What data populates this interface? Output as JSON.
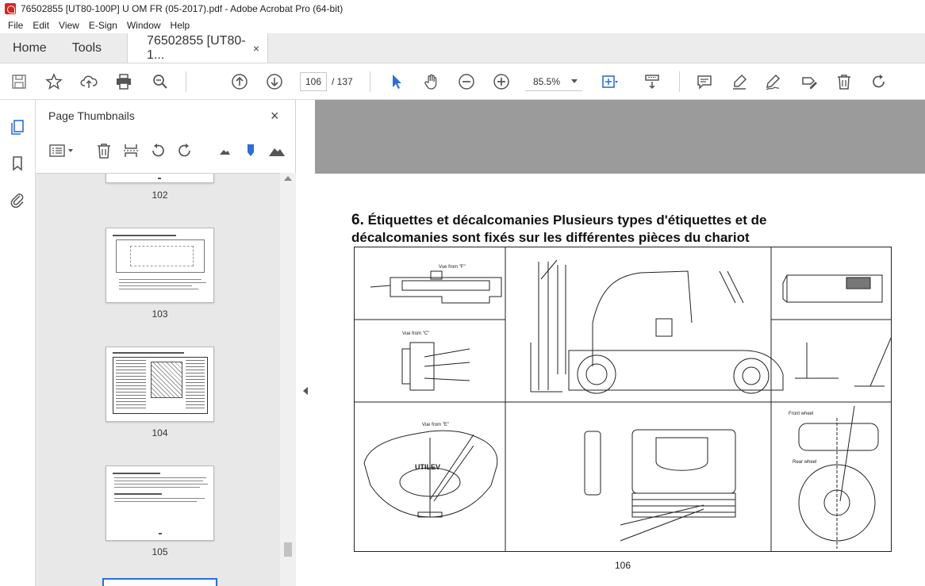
{
  "window": {
    "title": "76502855 [UT80-100P] U OM FR (05-2017).pdf - Adobe Acrobat Pro (64-bit)"
  },
  "menu": [
    "File",
    "Edit",
    "View",
    "E-Sign",
    "Window",
    "Help"
  ],
  "tabs": {
    "home": "Home",
    "tools": "Tools",
    "document": "76502855 [UT80-1...",
    "close": "×"
  },
  "toolbar": {
    "current_page": "106",
    "page_total": "/ 137",
    "zoom": "85.5%",
    "icons": [
      "save-icon",
      "star-icon",
      "upload-icon",
      "print-icon",
      "search-zoom-icon",
      "page-up-icon",
      "page-down-icon",
      "select-cursor-icon",
      "hand-icon",
      "zoom-out-icon",
      "zoom-in-icon",
      "zoom-dropdown-icon",
      "fit-page-icon",
      "scroll-mode-icon",
      "comment-icon",
      "highlight-icon",
      "sign-icon",
      "edit-icon",
      "delete-icon",
      "redo-icon"
    ]
  },
  "rail": {
    "icons": [
      "pages-icon",
      "bookmark-icon",
      "attachment-icon"
    ]
  },
  "panel": {
    "title": "Page Thumbnails",
    "close": "×",
    "tools": [
      "options-menu-icon",
      "delete-page-icon",
      "extract-page-icon",
      "rotate-ccw-icon",
      "rotate-cw-icon",
      "small-thumbnails-icon",
      "zoom-slider-icon",
      "large-thumbnails-icon"
    ],
    "thumbnails": [
      {
        "page": "102"
      },
      {
        "page": "103"
      },
      {
        "page": "104"
      },
      {
        "page": "105"
      }
    ]
  },
  "document": {
    "heading_num": "6.",
    "heading_text": " Étiquettes et décalcomanies Plusieurs types d'étiquettes et de décalcomanies sont fixés sur les différentes pièces du chariot",
    "page_number": "106",
    "figure_labels": {
      "view_f": "Vue from \"F\"",
      "view_c": "Vue from \"C\"",
      "view_e": "Vue from \"E\"",
      "front_wheel": "Front wheel",
      "rear_wheel": "Rear wheel",
      "brand": "UTILEV"
    }
  },
  "colors": {
    "accent_blue": "#2b6fd6",
    "docview_gray": "#9b9b9b",
    "brand_red": "#d7261e"
  }
}
